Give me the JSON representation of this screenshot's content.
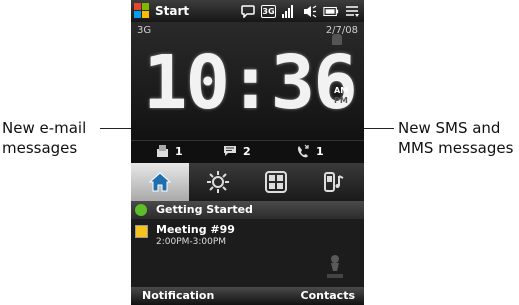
{
  "callouts": {
    "left": [
      "New e-mail",
      "messages"
    ],
    "right": [
      "New SMS and",
      "MMS messages"
    ]
  },
  "title_bar": {
    "title": "Start",
    "status_icons": [
      "chat-icon",
      "3g-icon",
      "signal-icon",
      "volume-icon",
      "battery-icon",
      "menu-icon"
    ]
  },
  "home": {
    "network": "3G",
    "date": "2/7/08",
    "time": "10:36",
    "am": "AM",
    "pm": "PM"
  },
  "counters": {
    "email": "1",
    "sms": "2",
    "missed_calls": "1"
  },
  "tabs": [
    {
      "icon": "home-icon",
      "active": true
    },
    {
      "icon": "sun-icon",
      "active": false
    },
    {
      "icon": "grid-icon",
      "active": false
    },
    {
      "icon": "phone-music-icon",
      "active": false
    }
  ],
  "list": {
    "getting_started": "Getting Started",
    "appointment_title": "Meeting #99",
    "appointment_time": "2:00PM-3:00PM"
  },
  "softkeys": {
    "left": "Notification",
    "right": "Contacts"
  },
  "colors": {
    "getting_started_icon": "#5cbf2a",
    "calendar_icon": "#f6c21c"
  }
}
